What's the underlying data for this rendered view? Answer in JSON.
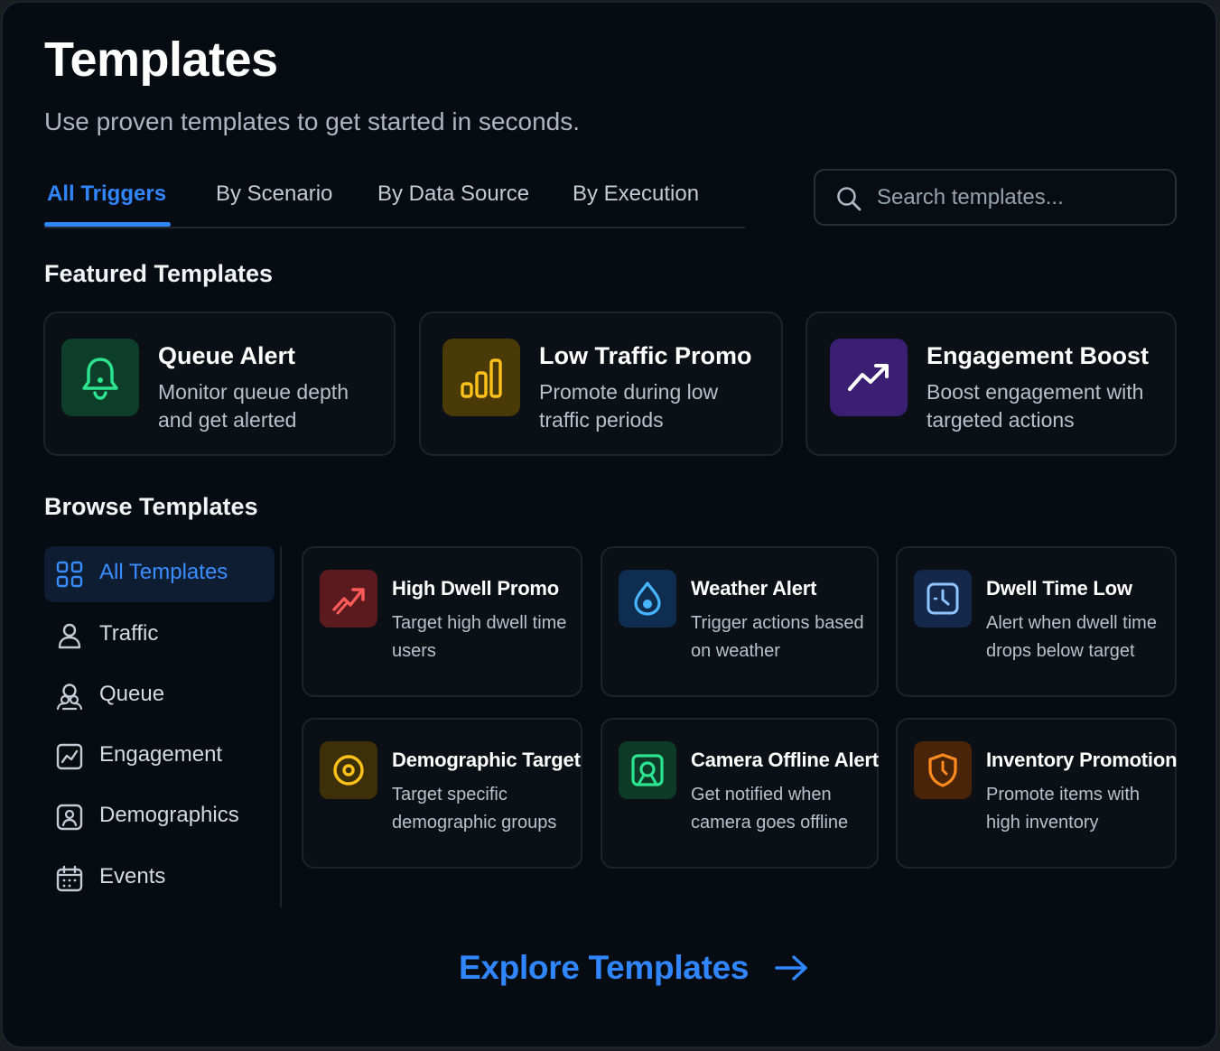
{
  "header": {
    "title": "Templates",
    "subtitle": "Use proven templates to get started in seconds."
  },
  "tabs": [
    {
      "label": "All Triggers",
      "active": true
    },
    {
      "label": "By Scenario",
      "active": false
    },
    {
      "label": "By Data Source",
      "active": false
    },
    {
      "label": "By Execution",
      "active": false
    }
  ],
  "search": {
    "placeholder": "Search templates...",
    "value": "",
    "icon": "search-icon"
  },
  "featured": {
    "title": "Featured Templates",
    "items": [
      {
        "name": "Queue Alert",
        "description": "Monitor queue depth and get alerted",
        "icon": "bell-icon",
        "color": "#2ee58f"
      },
      {
        "name": "Low Traffic Promo",
        "description": "Promote during low traffic periods",
        "icon": "bar-chart-icon",
        "color": "#ffc21a"
      },
      {
        "name": "Engagement Boost",
        "description": "Boost engagement with targeted actions",
        "icon": "trending-up-icon",
        "color": "#ffffff"
      }
    ]
  },
  "browse": {
    "title": "Browse Templates",
    "categories": [
      {
        "label": "All Templates",
        "icon": "grid-icon",
        "active": true
      },
      {
        "label": "Traffic",
        "icon": "person-icon",
        "active": false
      },
      {
        "label": "Queue",
        "icon": "people-icon",
        "active": false
      },
      {
        "label": "Engagement",
        "icon": "chart-icon",
        "active": false
      },
      {
        "label": "Demographics",
        "icon": "demographics-icon",
        "active": false
      },
      {
        "label": "Events",
        "icon": "calendar-icon",
        "active": false
      }
    ],
    "items": [
      {
        "name": "High Dwell Promo",
        "description": "Target high dwell time users",
        "icon": "trend-up-icon",
        "color": "#ff5b5b"
      },
      {
        "name": "Weather Alert",
        "description": "Trigger actions based on weather",
        "icon": "droplet-icon",
        "color": "#48b6ff"
      },
      {
        "name": "Dwell Time Low",
        "description": "Alert when dwell time drops below target",
        "icon": "clock-icon",
        "color": "#8fc4ff"
      },
      {
        "name": "Demographic Target",
        "description": "Target specific demographic groups",
        "icon": "target-icon",
        "color": "#ffc21a"
      },
      {
        "name": "Camera Offline Alert",
        "description": "Get notified when camera goes offline",
        "icon": "camera-icon",
        "color": "#2ee58f"
      },
      {
        "name": "Inventory Promotion",
        "description": "Promote items with high inventory",
        "icon": "shield-icon",
        "color": "#ff8a1f"
      }
    ]
  },
  "cta": {
    "label": "Explore Templates",
    "icon": "arrow-right-icon"
  }
}
